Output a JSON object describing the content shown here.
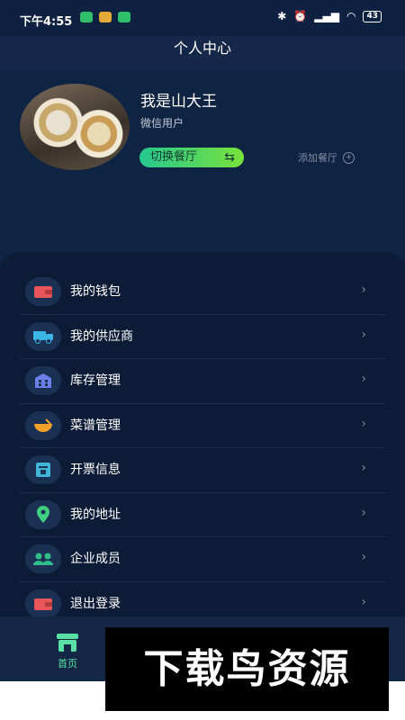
{
  "status_bar": {
    "time": "下午4:55",
    "battery": "43"
  },
  "header": {
    "title": "个人中心"
  },
  "profile": {
    "name": "我是山大王",
    "account_type": "微信用户",
    "switch_label": "切换餐厅",
    "add_label": "添加餐厅"
  },
  "menu": {
    "items": [
      {
        "label": "我的钱包",
        "icon": "wallet-icon",
        "color": "#e9565a"
      },
      {
        "label": "我的供应商",
        "icon": "truck-icon",
        "color": "#3bb4e6"
      },
      {
        "label": "库存管理",
        "icon": "warehouse-icon",
        "color": "#6b7fe8"
      },
      {
        "label": "菜谱管理",
        "icon": "bowl-icon",
        "color": "#f2a12a"
      },
      {
        "label": "开票信息",
        "icon": "invoice-icon",
        "color": "#3fb6d9"
      },
      {
        "label": "我的地址",
        "icon": "location-pin-icon",
        "color": "#3fcf7f"
      },
      {
        "label": "企业成员",
        "icon": "members-icon",
        "color": "#2fbf8a"
      },
      {
        "label": "退出登录",
        "icon": "logout-icon",
        "color": "#e9565a"
      }
    ]
  },
  "tabbar": {
    "home_label": "首页"
  },
  "watermark": {
    "text": "下载鸟资源"
  }
}
